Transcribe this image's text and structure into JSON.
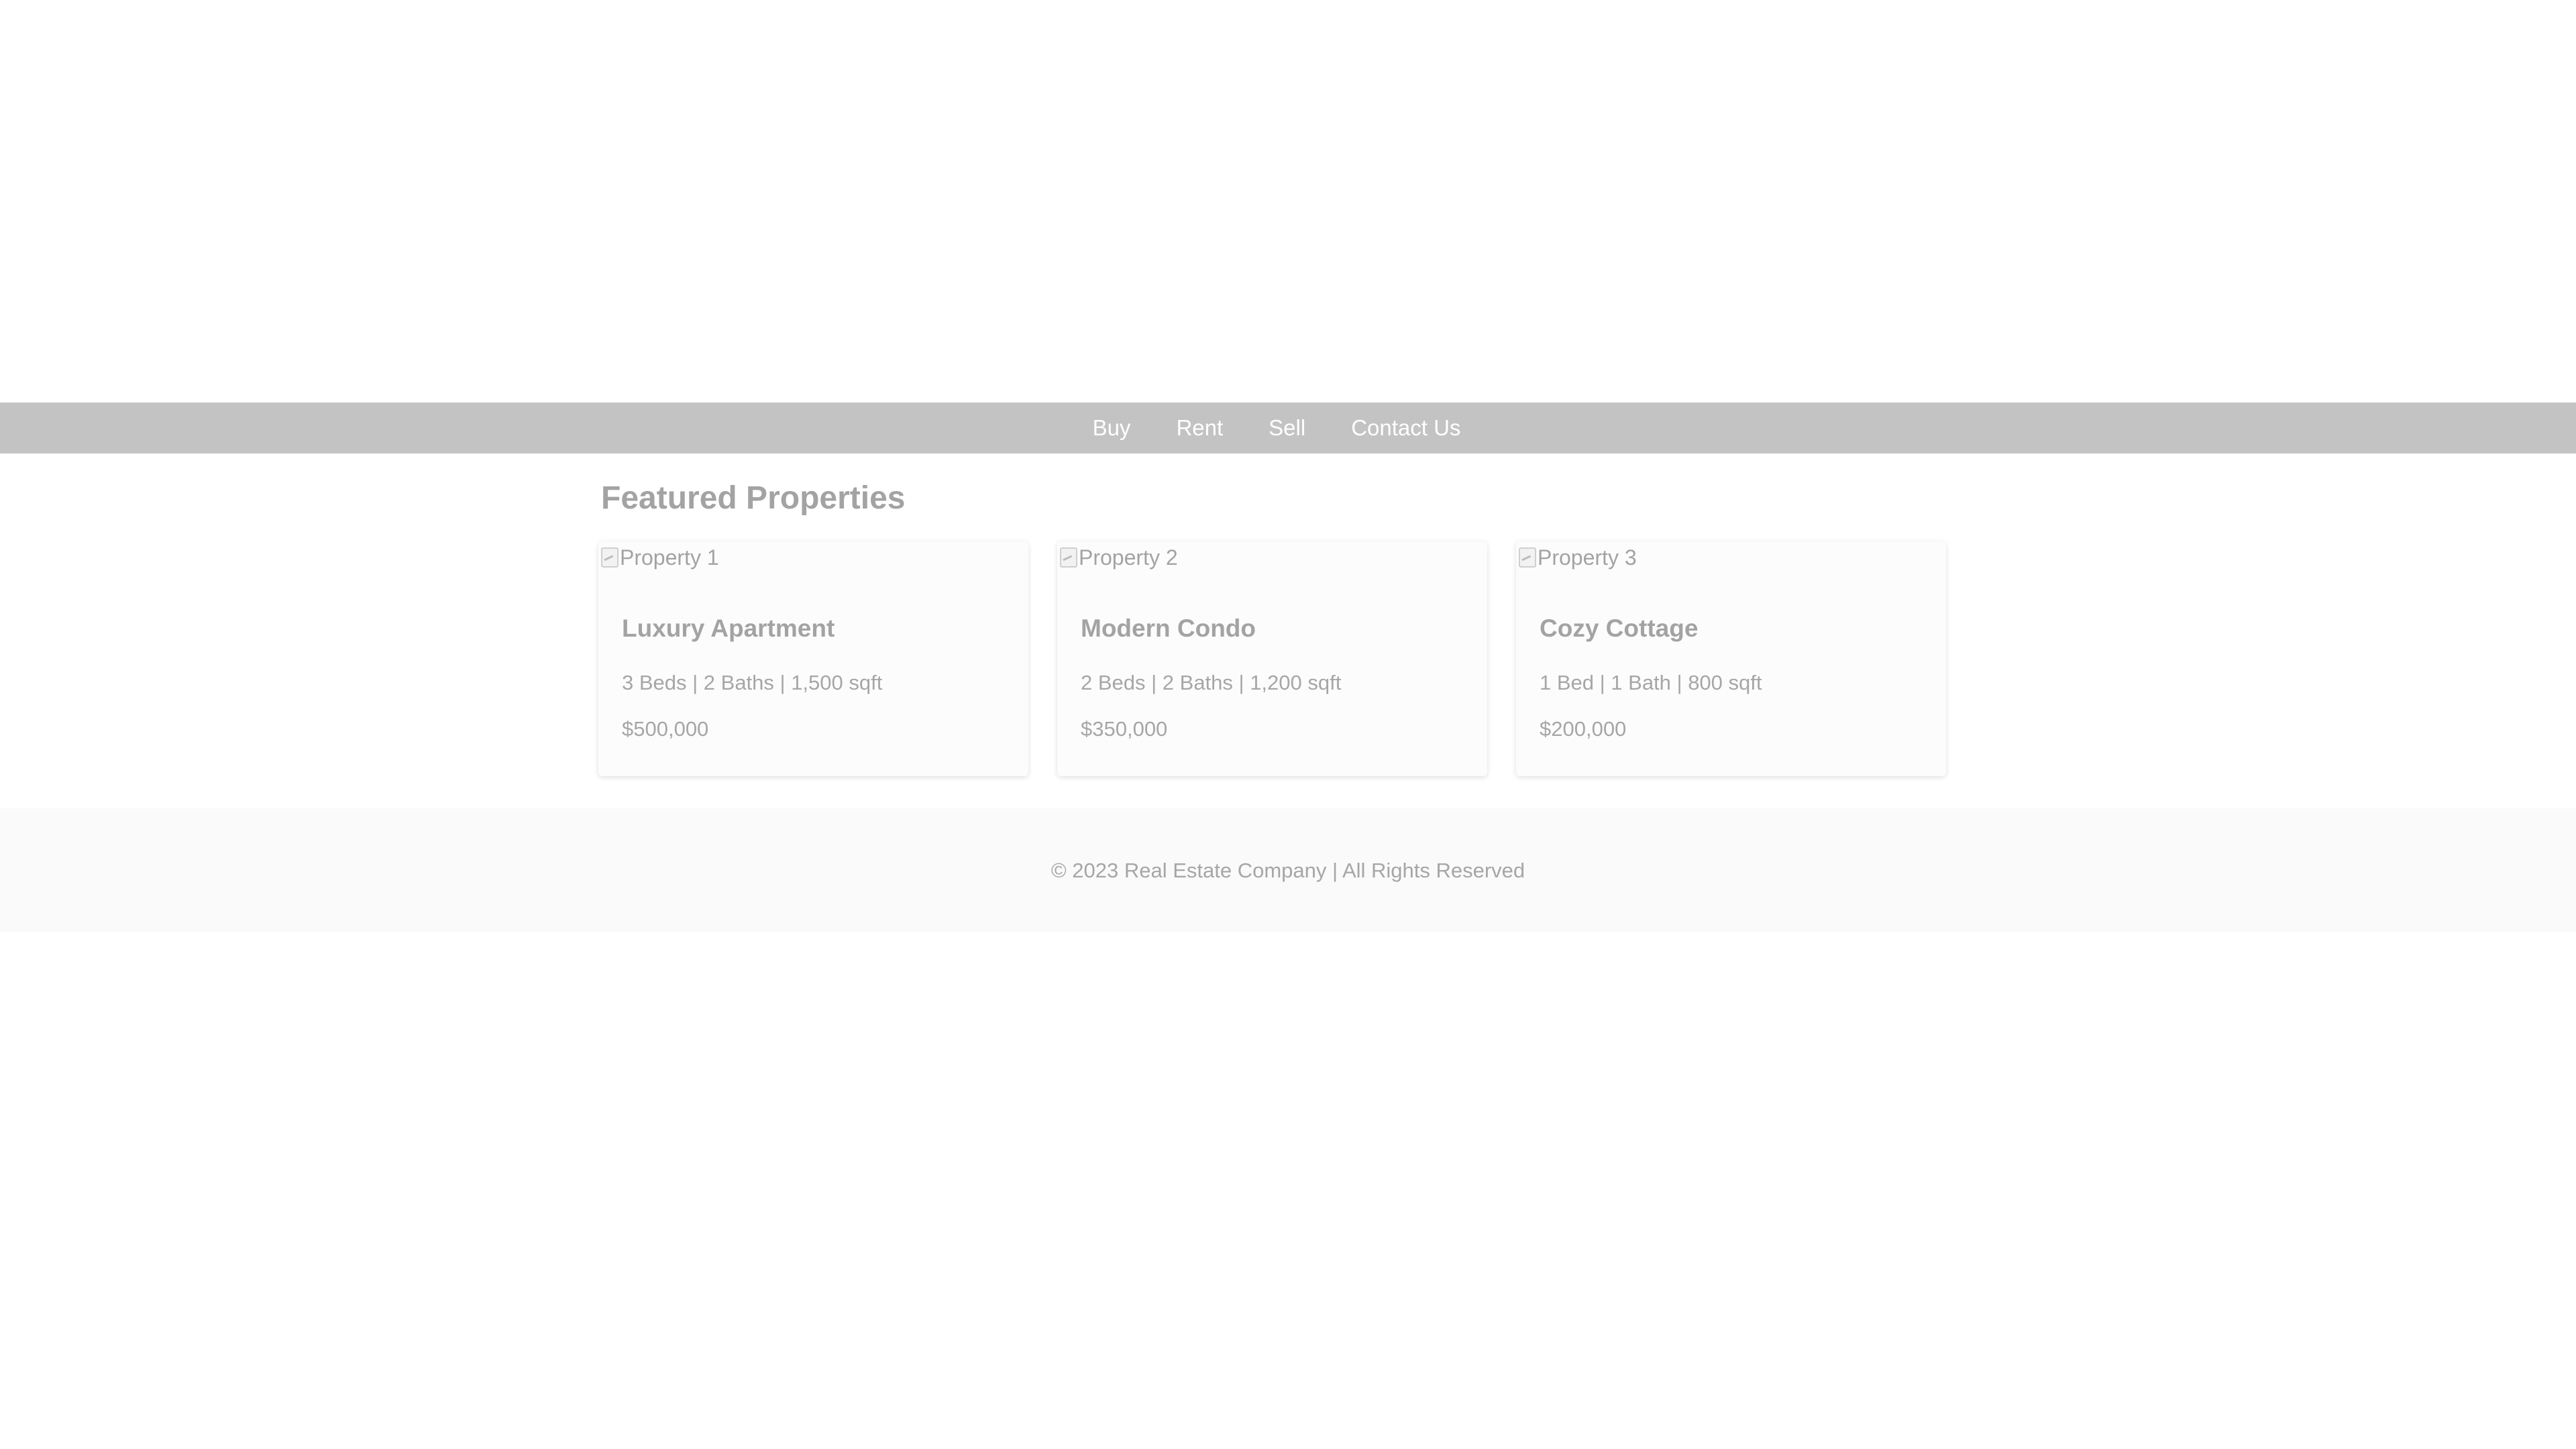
{
  "nav": {
    "items": [
      {
        "label": "Buy"
      },
      {
        "label": "Rent"
      },
      {
        "label": "Sell"
      },
      {
        "label": "Contact Us"
      }
    ]
  },
  "main": {
    "section_title": "Featured Properties",
    "properties": [
      {
        "image_alt": "Property 1",
        "title": "Luxury Apartment",
        "details": "3 Beds | 2 Baths | 1,500 sqft",
        "price": "$500,000"
      },
      {
        "image_alt": "Property 2",
        "title": "Modern Condo",
        "details": "2 Beds | 2 Baths | 1,200 sqft",
        "price": "$350,000"
      },
      {
        "image_alt": "Property 3",
        "title": "Cozy Cottage",
        "details": "1 Bed | 1 Bath | 800 sqft",
        "price": "$200,000"
      }
    ]
  },
  "footer": {
    "text": "© 2023 Real Estate Company | All Rights Reserved"
  },
  "colors": {
    "navbar_bg": "#c3c3c3",
    "nav_text": "#ffffff",
    "title_text": "#a3a3a3",
    "body_text": "#a6a6a6",
    "footer_bg": "#fafafa"
  }
}
